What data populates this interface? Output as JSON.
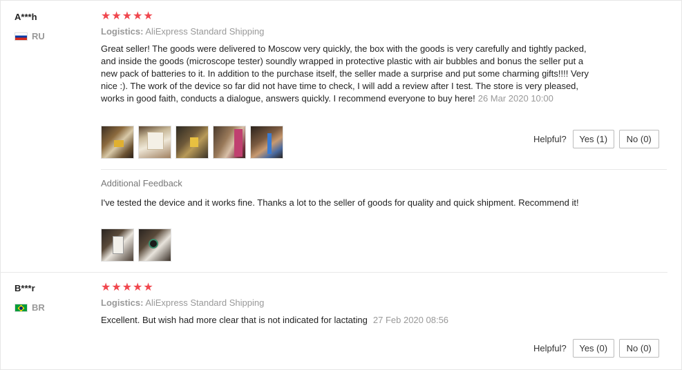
{
  "reviews": [
    {
      "user": "A***h",
      "country": "RU",
      "rating": "★★★★★",
      "logistics_label": "Logistics:",
      "logistics_value": "AliExpress Standard Shipping",
      "text": "Great seller! The goods were delivered to Moscow very quickly, the box with the goods is very carefully and tightly packed, and inside the goods (microscope tester) soundly wrapped in protective plastic with air bubbles and bonus the seller put a new pack of batteries to it. In addition to the purchase itself, the seller made a surprise and put some charming gifts!!!! Very nice :). The work of the device so far did not have time to check, I will add a review after I test. The store is very pleased, works in good faith, conducts a dialogue, answers quickly. I recommend everyone to buy here!",
      "date": "26 Mar 2020 10:00",
      "helpful_label": "Helpful?",
      "yes_label": "Yes (1)",
      "no_label": "No (0)",
      "additional": {
        "title": "Additional Feedback",
        "text": "I've tested the device and it works fine. Thanks a lot to the seller of goods for quality and quick shipment. Recommend it!"
      }
    },
    {
      "user": "B***r",
      "country": "BR",
      "rating": "★★★★★",
      "logistics_label": "Logistics:",
      "logistics_value": "AliExpress Standard Shipping",
      "text": "Excellent. But wish had more clear that is not indicated for lactating",
      "date": "27 Feb 2020 08:56",
      "helpful_label": "Helpful?",
      "yes_label": "Yes (0)",
      "no_label": "No (0)"
    }
  ],
  "colors": {
    "star": "#f0474e",
    "muted": "#999999",
    "border": "#e8e8e8"
  }
}
